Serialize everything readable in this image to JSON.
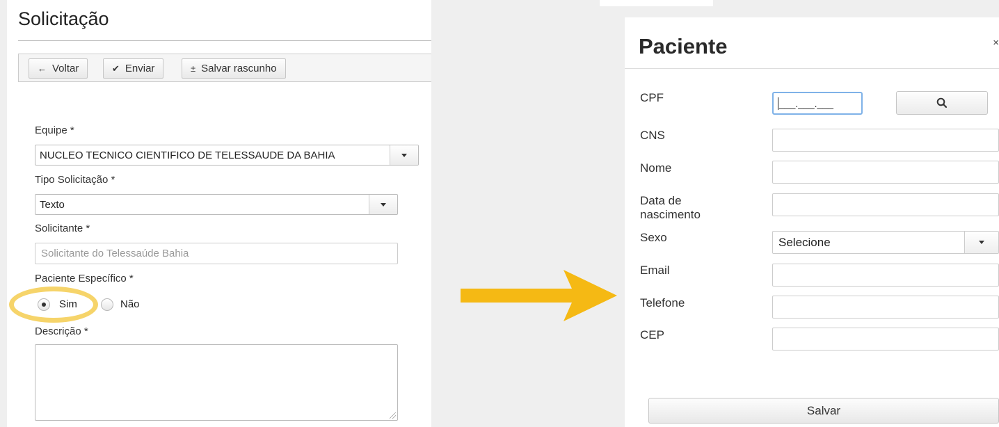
{
  "left": {
    "title": "Solicitação",
    "toolbar": {
      "back": {
        "icon": "←",
        "label": "Voltar"
      },
      "send": {
        "icon": "✔",
        "label": "Enviar"
      },
      "draft": {
        "icon": "±",
        "label": "Salvar rascunho"
      }
    },
    "equipe": {
      "label": "Equipe *",
      "value": "NUCLEO TECNICO CIENTIFICO DE TELESSAUDE DA BAHIA"
    },
    "tipo": {
      "label": "Tipo Solicitação *",
      "value": "Texto"
    },
    "solicitante": {
      "label": "Solicitante *",
      "placeholder": "Solicitante do Telessaúde Bahia"
    },
    "paciente_especifico": {
      "label": "Paciente Específico *",
      "options": [
        "Sim",
        "Não"
      ],
      "selected": "Sim"
    },
    "descricao": {
      "label": "Descrição *",
      "value": ""
    }
  },
  "arrow_color": "#f5b914",
  "highlight_color": "#f6d46a",
  "right": {
    "title": "Paciente",
    "close_icon": "×",
    "fields": {
      "cpf": {
        "label": "CPF",
        "mask": "___.___.___"
      },
      "cns": {
        "label": "CNS",
        "value": ""
      },
      "nome": {
        "label": "Nome",
        "value": ""
      },
      "nascimento": {
        "label_line1": "Data de",
        "label_line2": "nascimento",
        "value": ""
      },
      "sexo": {
        "label": "Sexo",
        "value": "Selecione"
      },
      "email": {
        "label": "Email",
        "value": ""
      },
      "telefone": {
        "label": "Telefone",
        "value": ""
      },
      "cep": {
        "label": "CEP",
        "value": ""
      }
    },
    "save_label": "Salvar"
  }
}
